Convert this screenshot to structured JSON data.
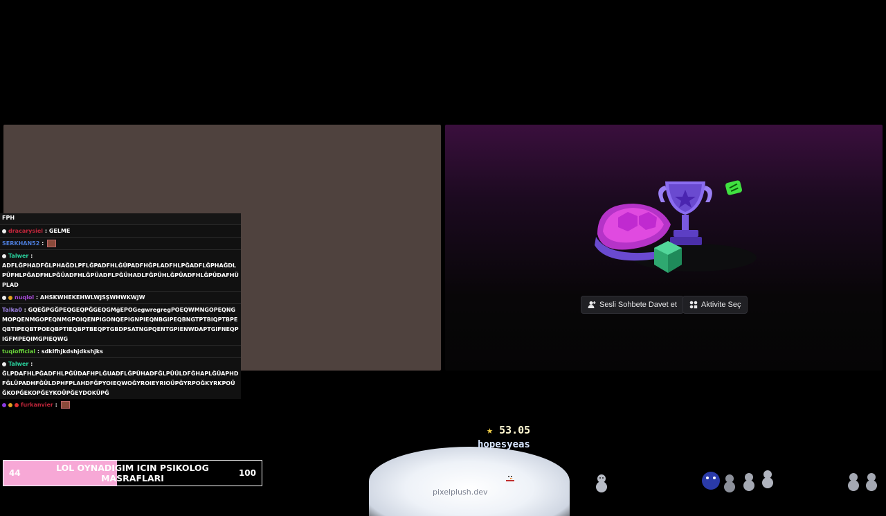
{
  "chat": {
    "title": "FPH",
    "messages": [
      {
        "user": "dracarysiel",
        "color": "#c0253a",
        "sep": " : ",
        "text": "GELME",
        "badges": [
          "badge"
        ]
      },
      {
        "user": "SERKHAN52",
        "color": "#4b7bd8",
        "sep": " : ",
        "text": "",
        "emote": true
      },
      {
        "user": "Talwer",
        "color": "#2ad6a0",
        "sep": " :",
        "text": "ADFLĞPHADFĞLPHAĞDLPFLĞPADFHLĞÜPADFHĞPLADFHLPĞADFLĞPHAĞDLPÜFHLPĞADFHLPĞÜADFHLĞPÜADFLPĞÜHADLFĞPÜHLĞPÜADFHLĞPÜDAFHÜPLAD",
        "badges": [
          "badge"
        ]
      },
      {
        "user": "nuqlol",
        "color": "#a84bd8",
        "sep": " : ",
        "text": "AHSKWHEKEHWLWJSŞWHWKWJW",
        "badges": [
          "badge",
          "badge-gold"
        ]
      },
      {
        "user": "Talka0",
        "color": "#a084e8",
        "sep": " : ",
        "text": "GQEĞPGĞPEQGEQPĞGEQGMğEPOGegwregregPOEQWMNGOPEQNGMOPQENMGOPEQNMGPOIQENPIGONQEPIGNPIEQNBGIPEQBNGTPTBIQPTBPEQBTIPEQBTPOEQBPTIEQBPTBEQPTGBDPSATNGPQENTGPIENWDAPTGIFNEQPIGFMPEQIMGPIEQWG"
      },
      {
        "user": "tuqiofficial",
        "color": "#6ad63a",
        "sep": " : ",
        "text": "sdklfhjkdshjdkshjks"
      },
      {
        "user": "Talwer",
        "color": "#2ad6a0",
        "sep": " :",
        "text": "ĞLPDAFHLPĞADFHLPĞÜDAFHPLĞUADFLĞPÜHADFĞLPÜÜLDFĞHAPLĞÜAPHDFĞLÜPADHFĞÜLDPHFPLAHDFĞPYOIEQWOĞYROIEYRIOÜPĞYRPOĞKYRKPOÜĞKOPĞEKOPĞEYKOÜPĞEYDOKÜPĞ",
        "badges": [
          "badge"
        ]
      },
      {
        "user": "furkanvier",
        "color": "#c0253a",
        "sep": " : ",
        "text": "",
        "emote": true,
        "badges": [
          "badge-purple",
          "badge-gold",
          "badge-red"
        ]
      }
    ]
  },
  "activity": {
    "invite_button": "Sesli Sohbete Davet et",
    "activity_button": "Aktivite Seç"
  },
  "goal": {
    "title": "LOL OYNADIGIM ICIN PSIKOLOG MASRAFLARI",
    "current": "44",
    "target": "100",
    "progress_fraction": 0.44,
    "fill_color": "#f7a8d6"
  },
  "game": {
    "score": "53.05",
    "player": "hopesyeas",
    "site": "pixelplush.dev"
  }
}
